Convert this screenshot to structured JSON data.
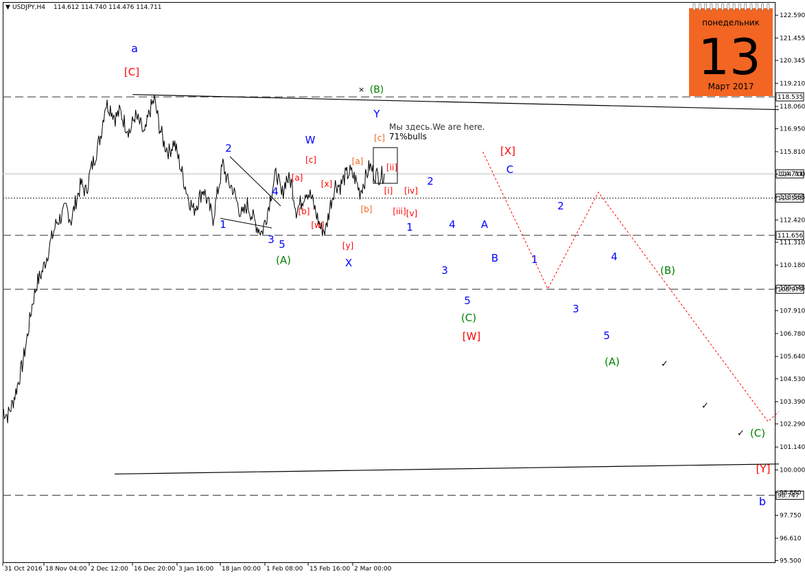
{
  "header": {
    "symbol": "USDJPY,H4",
    "ohlc": "114.612 114.740 114.476 114.711"
  },
  "calendar": {
    "weekday": "понедельник",
    "day": "13",
    "month_year": "Март 2017",
    "color": "#f26522"
  },
  "note": {
    "line1": "Мы здесь.We are here.",
    "line2": "71%bulls"
  },
  "colors": {
    "blue": "#0000ff",
    "red": "#ff0000",
    "green": "#008000",
    "orange": "#f26522",
    "path": "#ff0000"
  },
  "chart_data": {
    "type": "line",
    "title": "USDJPY,H4",
    "xlabel": "",
    "ylabel": "",
    "ylim": [
      94.9,
      123.6
    ],
    "grid": false,
    "y_ticks": [
      "122.590",
      "121.455",
      "120.345",
      "119.210",
      "118.060",
      "116.950",
      "115.810",
      "114.700",
      "113.565",
      "112.420",
      "111.310",
      "110.180",
      "109.045",
      "107.910",
      "106.780",
      "105.640",
      "104.530",
      "103.390",
      "102.290",
      "101.140",
      "100.000",
      "98.880",
      "97.750",
      "96.610",
      "95.500"
    ],
    "x_ticks": [
      "31 Oct 2016",
      "18 Nov 04:00",
      "2 Dec 12:00",
      "16 Dec 20:00",
      "3 Jan 16:00",
      "18 Jan 00:00",
      "1 Feb 08:00",
      "15 Feb 16:00",
      "2 Mar 00:00"
    ],
    "levels": [
      {
        "price": 118.535,
        "label": "118.535",
        "style": "dashed"
      },
      {
        "price": 114.711,
        "label": "114.711",
        "style": "solid-gray"
      },
      {
        "price": 113.508,
        "label": "113.508",
        "style": "dotted"
      },
      {
        "price": 111.656,
        "label": "111.656",
        "style": "dashed"
      },
      {
        "price": 108.979,
        "label": "108.979",
        "style": "dashed"
      },
      {
        "price": 98.747,
        "label": "98.747",
        "style": "dashed"
      }
    ],
    "price_path": [
      103.0,
      102.7,
      103.3,
      104.2,
      105.2,
      106.6,
      108.2,
      109.3,
      109.8,
      110.6,
      111.5,
      112.3,
      112.6,
      113.0,
      112.4,
      113.4,
      114.2,
      113.8,
      114.9,
      115.7,
      116.6,
      118.2,
      118.0,
      117.5,
      117.8,
      117.2,
      116.8,
      117.6,
      117.2,
      116.6,
      117.8,
      118.4,
      117.1,
      116.2,
      115.8,
      116.3,
      115.4,
      114.4,
      113.5,
      112.9,
      113.4,
      114.0,
      113.2,
      112.5,
      113.9,
      115.2,
      114.3,
      114.0,
      113.2,
      112.6,
      113.2,
      112.6,
      112.1,
      111.8,
      112.7,
      113.9,
      114.8,
      113.6,
      114.5,
      114.3,
      112.9,
      113.3,
      113.9,
      113.6,
      112.8,
      112.0,
      111.9,
      113.2,
      114.2,
      114.1,
      114.6,
      114.8,
      114.5,
      113.8,
      114.4,
      115.1,
      114.7,
      114.6,
      114.711
    ],
    "forecast_path": [
      {
        "date": "2017-03-13",
        "price": 115.8
      },
      {
        "date": "2017-03-31",
        "price": 109.0
      },
      {
        "date": "2017-04-14",
        "price": 113.8
      },
      {
        "date": "2017-05-31",
        "price": 102.4
      },
      {
        "date": "2017-06-03",
        "price": 102.9
      }
    ],
    "trendlines": [
      {
        "from": {
          "date": "2016-12-06",
          "price": 118.65
        },
        "to": {
          "date": "2017-06-03",
          "price": 117.9
        }
      },
      {
        "from": {
          "date": "2016-12-01",
          "price": 99.8
        },
        "to": {
          "date": "2017-06-03",
          "price": 100.3
        }
      }
    ],
    "wave_labels": [
      {
        "text": "a",
        "color": "blue",
        "x": 1,
        "y": 0
      },
      {
        "text": "[C]",
        "color": "red",
        "x": 1,
        "y": 0
      },
      {
        "text": "(B)",
        "color": "green",
        "x": 0,
        "y": 0
      },
      {
        "text": "W",
        "color": "blue",
        "x": 0,
        "y": 0
      },
      {
        "text": "Y",
        "color": "blue",
        "x": 0,
        "y": 0
      },
      {
        "text": "2",
        "color": "blue",
        "x": 0,
        "y": 0
      },
      {
        "text": "4",
        "color": "blue",
        "x": 0,
        "y": 0
      },
      {
        "text": "1",
        "color": "blue",
        "x": 0,
        "y": 0
      },
      {
        "text": "3",
        "color": "blue",
        "x": 0,
        "y": 0
      },
      {
        "text": "5",
        "color": "blue",
        "x": 0,
        "y": 0
      },
      {
        "text": "(A)",
        "color": "green",
        "x": 0,
        "y": 0
      },
      {
        "text": "X",
        "color": "blue",
        "x": 0,
        "y": 0
      },
      {
        "text": "[c]",
        "color": "red",
        "x": 0,
        "y": 0
      },
      {
        "text": "[a]",
        "color": "red",
        "x": 0,
        "y": 0
      },
      {
        "text": "[x]",
        "color": "red",
        "x": 0,
        "y": 0
      },
      {
        "text": "[b]",
        "color": "red",
        "x": 0,
        "y": 0
      },
      {
        "text": "[w]",
        "color": "red",
        "x": 0,
        "y": 0
      },
      {
        "text": "[y]",
        "color": "red",
        "x": 0,
        "y": 0
      },
      {
        "text": "[c]",
        "color": "orange",
        "x": 0,
        "y": 0
      },
      {
        "text": "[a]",
        "color": "orange",
        "x": 0,
        "y": 0
      },
      {
        "text": "[b]",
        "color": "orange",
        "x": 0,
        "y": 0
      },
      {
        "text": "[ii]",
        "color": "red",
        "x": 0,
        "y": 0
      },
      {
        "text": "[i]",
        "color": "red",
        "x": 0,
        "y": 0
      },
      {
        "text": "[iv]",
        "color": "red",
        "x": 0,
        "y": 0
      },
      {
        "text": "[iii]",
        "color": "red",
        "x": 0,
        "y": 0
      },
      {
        "text": "[v]",
        "color": "red",
        "x": 0,
        "y": 0
      },
      {
        "text": "2",
        "color": "blue",
        "x": 0,
        "y": 0
      },
      {
        "text": "1",
        "color": "blue",
        "x": 0,
        "y": 0
      },
      {
        "text": "4",
        "color": "blue",
        "x": 0,
        "y": 0
      },
      {
        "text": "3",
        "color": "blue",
        "x": 0,
        "y": 0
      },
      {
        "text": "5",
        "color": "blue",
        "x": 0,
        "y": 0
      },
      {
        "text": "A",
        "color": "blue",
        "x": 0,
        "y": 0
      },
      {
        "text": "B",
        "color": "blue",
        "x": 0,
        "y": 0
      },
      {
        "text": "C",
        "color": "blue",
        "x": 0,
        "y": 0
      },
      {
        "text": "[X]",
        "color": "red",
        "x": 0,
        "y": 0
      },
      {
        "text": "(C)",
        "color": "green",
        "x": 0,
        "y": 0
      },
      {
        "text": "[W]",
        "color": "red",
        "x": 0,
        "y": 0
      },
      {
        "text": "2",
        "color": "blue",
        "x": 0,
        "y": 0
      },
      {
        "text": "1",
        "color": "blue",
        "x": 0,
        "y": 0
      },
      {
        "text": "4",
        "color": "blue",
        "x": 0,
        "y": 0
      },
      {
        "text": "3",
        "color": "blue",
        "x": 0,
        "y": 0
      },
      {
        "text": "5",
        "color": "blue",
        "x": 0,
        "y": 0
      },
      {
        "text": "(B)",
        "color": "green",
        "x": 0,
        "y": 0
      },
      {
        "text": "(A)",
        "color": "green",
        "x": 0,
        "y": 0
      },
      {
        "text": "(C)",
        "color": "green",
        "x": 0,
        "y": 0
      },
      {
        "text": "[Y]",
        "color": "red",
        "x": 0,
        "y": 0
      },
      {
        "text": "b",
        "color": "blue",
        "x": 0,
        "y": 0
      }
    ]
  }
}
